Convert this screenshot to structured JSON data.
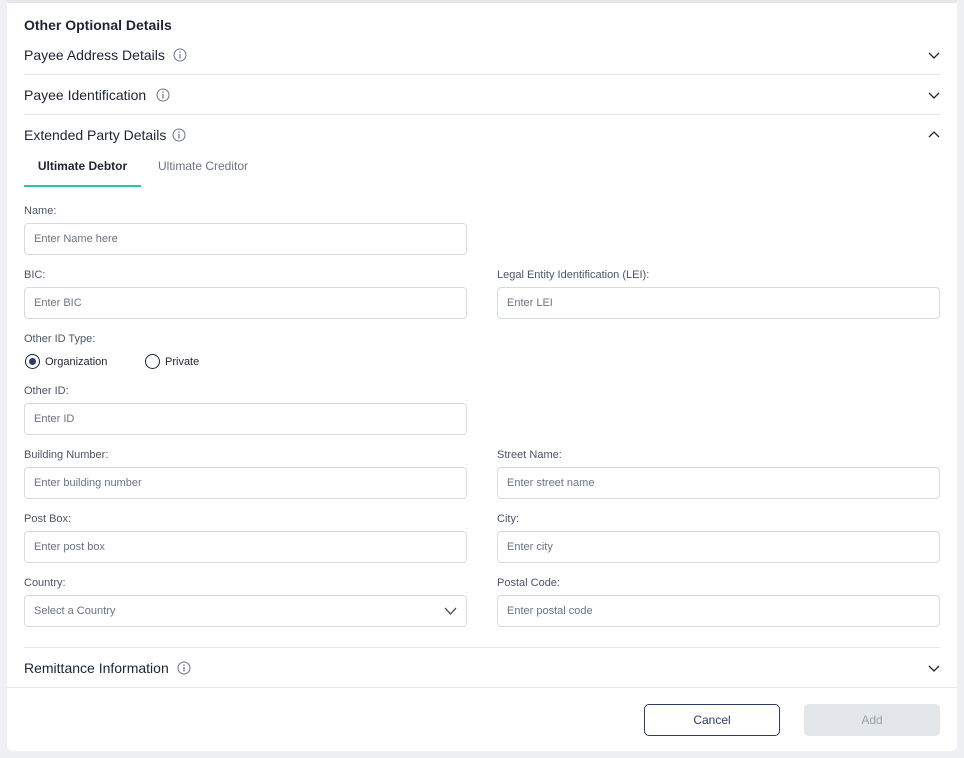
{
  "section_title": "Other Optional Details",
  "accordions": {
    "payee_address": "Payee Address Details",
    "payee_identification": "Payee Identification",
    "extended_party": "Extended Party Details",
    "remittance": "Remittance Information"
  },
  "tabs": {
    "active": "Ultimate Debtor",
    "inactive": "Ultimate Creditor"
  },
  "form": {
    "name_label": "Name:",
    "name_placeholder": "Enter Name here",
    "bic_label": "BIC:",
    "bic_placeholder": "Enter BIC",
    "lei_label": "Legal Entity Identification (LEI):",
    "lei_placeholder": "Enter LEI",
    "other_id_type_label": "Other ID Type:",
    "radio_org": "Organization",
    "radio_private": "Private",
    "other_id_label": "Other ID:",
    "other_id_placeholder": "Enter ID",
    "building_label": "Building Number:",
    "building_placeholder": "Enter building number",
    "street_label": "Street Name:",
    "street_placeholder": "Enter street name",
    "postbox_label": "Post Box:",
    "postbox_placeholder": "Enter post box",
    "city_label": "City:",
    "city_placeholder": "Enter city",
    "country_label": "Country:",
    "country_value": "Select a Country",
    "postal_label": "Postal Code:",
    "postal_placeholder": "Enter postal code"
  },
  "buttons": {
    "cancel": "Cancel",
    "add": "Add"
  },
  "colors": {
    "accent_tab": "#2ec4a6",
    "primary": "#2d3a6b",
    "disabled": "#e3e6eb"
  },
  "icons": {
    "info": "info-circle-icon",
    "chevron_down": "chevron-down-icon",
    "chevron_up": "chevron-up-icon"
  }
}
